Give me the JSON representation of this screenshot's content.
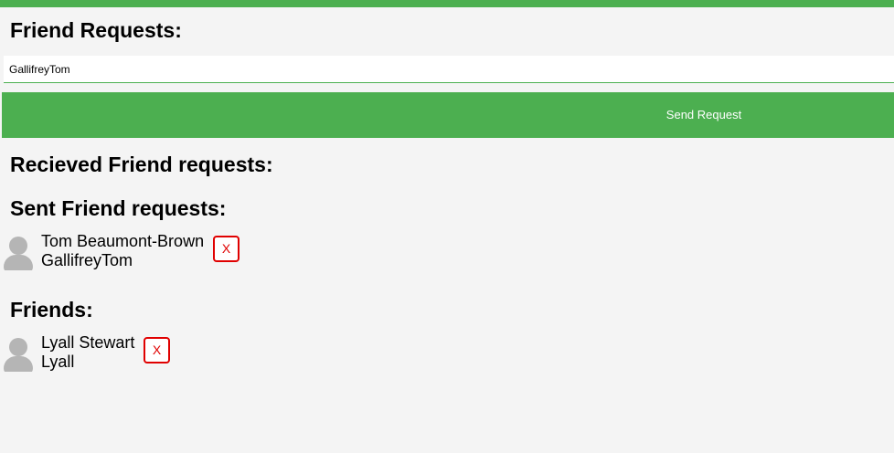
{
  "friend_requests": {
    "title": "Friend Requests:",
    "input_value": "GallifreyTom",
    "send_button_label": "Send Request"
  },
  "received": {
    "title": "Recieved Friend requests:"
  },
  "sent": {
    "title": "Sent Friend requests:",
    "items": [
      {
        "name": "Tom Beaumont-Brown",
        "username": "GallifreyTom",
        "remove_label": "X"
      }
    ]
  },
  "friends": {
    "title": "Friends:",
    "items": [
      {
        "name": "Lyall Stewart",
        "username": "Lyall",
        "remove_label": "X"
      }
    ]
  },
  "colors": {
    "accent": "#4caf50",
    "background": "#f4f4f4",
    "danger": "#e00000",
    "avatar": "#b5b5b5"
  }
}
